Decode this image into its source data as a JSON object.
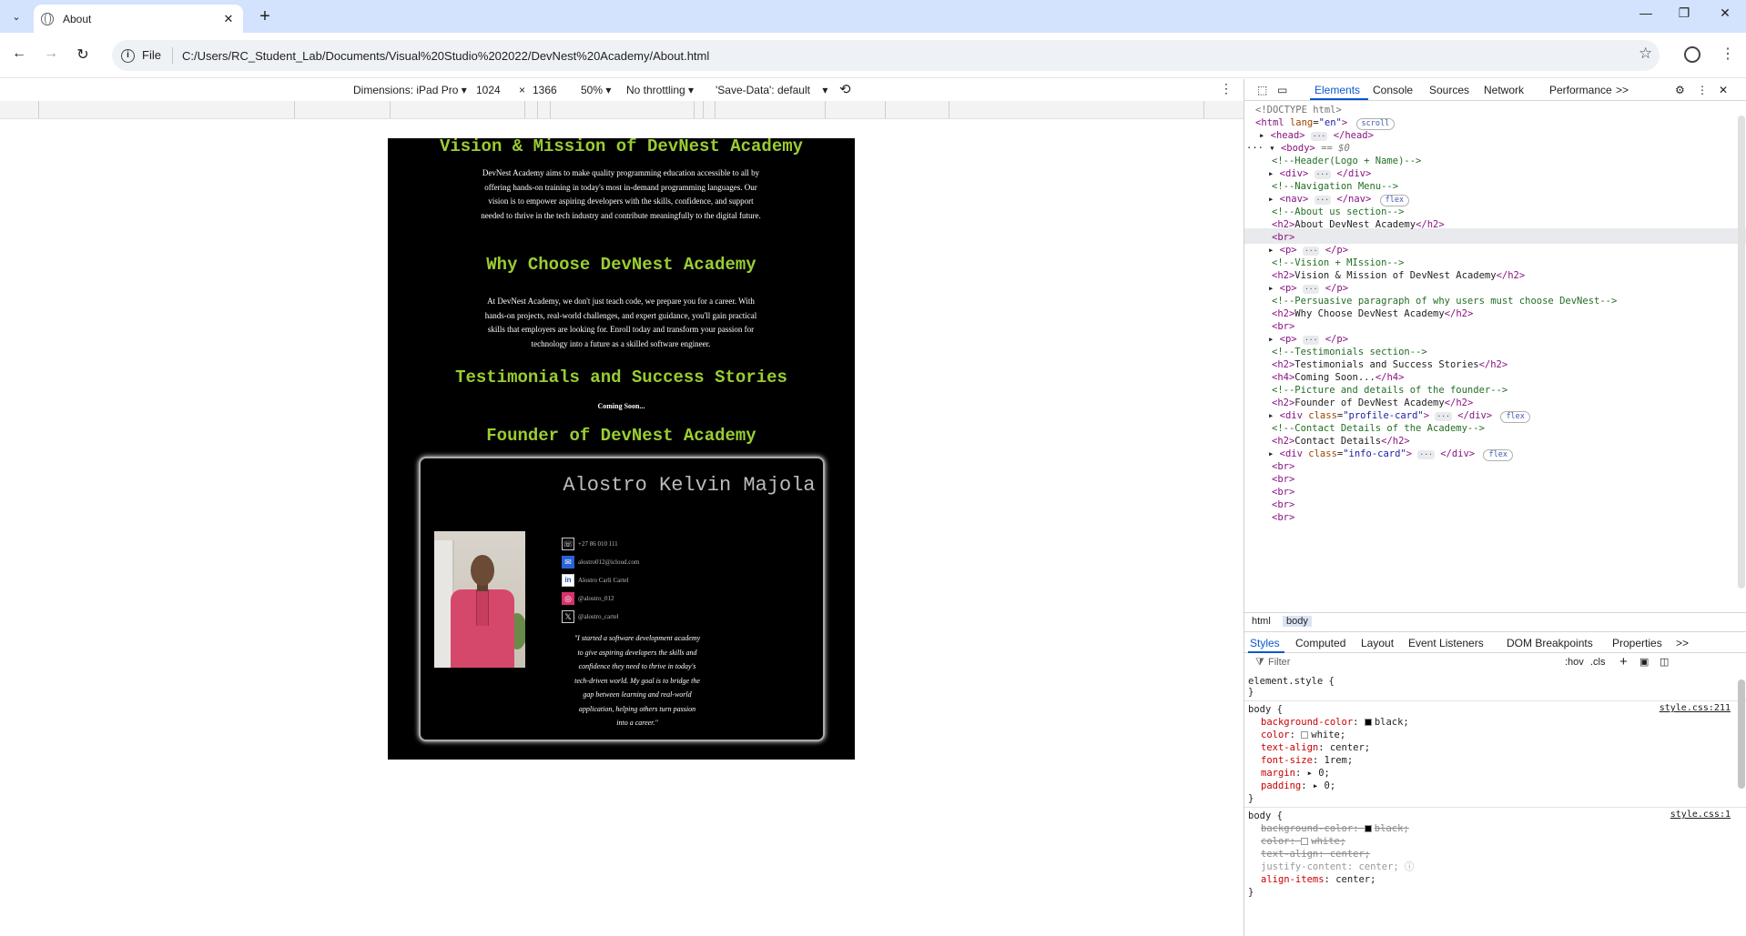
{
  "browser": {
    "tab_title": "About",
    "file_label": "File",
    "url": "C:/Users/RC_Student_Lab/Documents/Visual%20Studio%202022/DevNest%20Academy/About.html"
  },
  "device_toolbar": {
    "dimensions": "Dimensions: iPad Pro",
    "width": "1024",
    "x": "×",
    "height": "1366",
    "zoom": "50%",
    "throttling": "No throttling",
    "save_data": "'Save-Data': default"
  },
  "page": {
    "vision_heading": "Vision & Mission of DevNest Academy",
    "vision_text": "DevNest Academy aims to make quality programming education accessible to all by offering hands-on training in today's most in-demand programming languages. Our vision is to empower aspiring developers with the skills, confidence, and support needed to thrive in the tech industry and contribute meaningfully to the digital future.",
    "why_heading": "Why Choose DevNest Academy",
    "why_text": "At DevNest Academy, we don't just teach code, we prepare you for a career. With hands-on projects, real-world challenges, and expert guidance, you'll gain practical skills that employers are looking for. Enroll today and transform your passion for technology into a future as a skilled software engineer.",
    "testimonials_heading": "Testimonials and Success Stories",
    "coming_soon": "Coming Soon...",
    "founder_heading": "Founder of DevNest Academy",
    "founder_name": "Alostro Kelvin Majola",
    "contacts": {
      "phone": "+27 86 010 111",
      "email": "alostro012@icloud.com",
      "linkedin": "Alostro Carli Cartel",
      "instagram": "@alostro_012",
      "x": "@alostro_cartel"
    },
    "quote": "\"I started a software development academy to give aspiring developers the skills and confidence they need to thrive in today's tech-driven world. My goal is to bridge the gap between learning and real-world application, helping others turn passion into a career.\""
  },
  "devtools": {
    "tabs": [
      "Elements",
      "Console",
      "Sources",
      "Network",
      "Performance"
    ],
    "more": ">>",
    "crumbs": [
      "html",
      "body"
    ],
    "styles_tabs": [
      "Styles",
      "Computed",
      "Layout",
      "Event Listeners",
      "DOM Breakpoints",
      "Properties"
    ],
    "filter_placeholder": "Filter",
    "hov": ":hov",
    "cls": ".cls",
    "rule1_source": "style.css:211",
    "rule2_source": "style.css:1",
    "colors": {
      "accent": "#0b57d0",
      "heading": "#9acd32"
    }
  }
}
